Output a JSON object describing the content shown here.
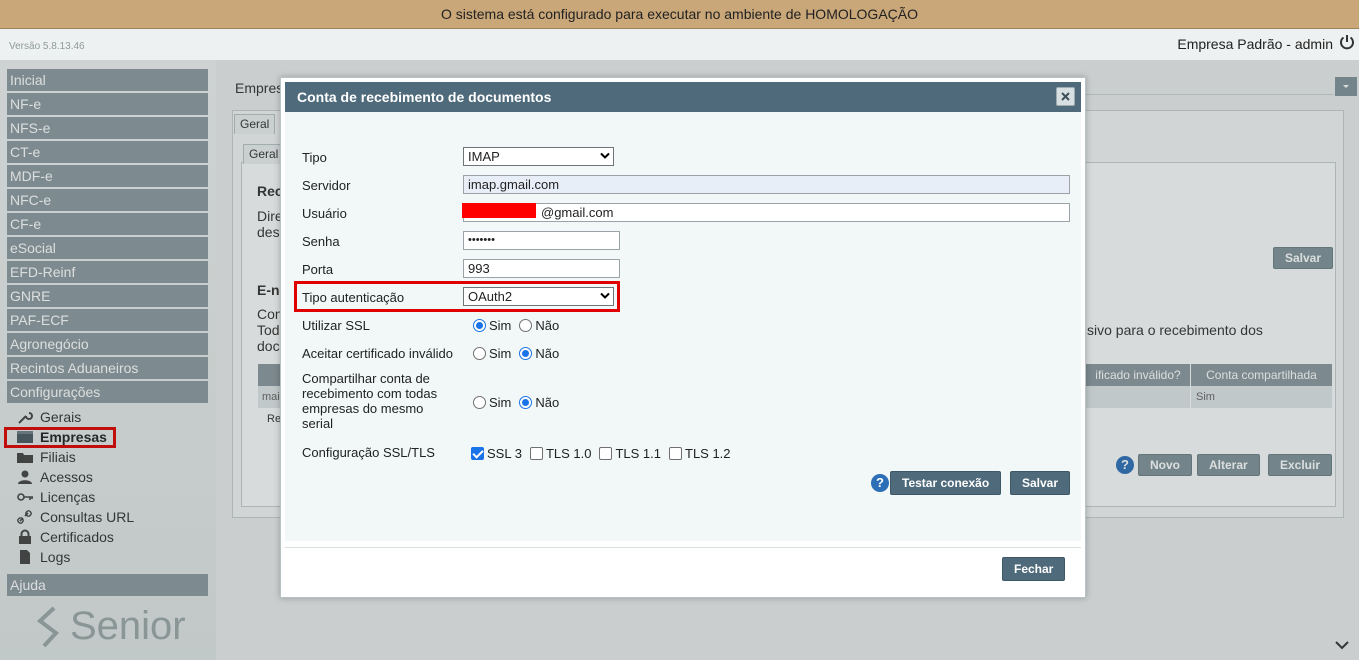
{
  "banner": {
    "text": "O sistema está configurado para executar no ambiente de HOMOLOGAÇÃO"
  },
  "header": {
    "version": "Versão 5.8.13.46",
    "user": "Empresa Padrão - admin"
  },
  "sidebar": {
    "menu": [
      "Inicial",
      "NF-e",
      "NFS-e",
      "CT-e",
      "MDF-e",
      "NFC-e",
      "CF-e",
      "eSocial",
      "EFD-Reinf",
      "GNRE",
      "PAF-ECF",
      "Agronegócio",
      "Recintos Aduaneiros",
      "Configurações"
    ],
    "config_items": [
      {
        "label": "Gerais",
        "icon": "wrench-icon"
      },
      {
        "label": "Empresas",
        "icon": "building-icon"
      },
      {
        "label": "Filiais",
        "icon": "folder-icon"
      },
      {
        "label": "Acessos",
        "icon": "user-icon"
      },
      {
        "label": "Licenças",
        "icon": "key-icon"
      },
      {
        "label": "Consultas URL",
        "icon": "link-icon"
      },
      {
        "label": "Certificados",
        "icon": "lock-icon"
      },
      {
        "label": "Logs",
        "icon": "document-icon"
      }
    ],
    "help": "Ajuda",
    "logo": "Senior"
  },
  "background": {
    "empresa_label": "Empres",
    "tab_outer": "Geral",
    "tab_inner": "Geral",
    "section1_title": "Rec",
    "section1_line1": "Dire",
    "section1_line2": "des",
    "section2_title": "E-n",
    "section2_line1": "Con",
    "section2_line2": "Tod",
    "section2_line3": "doc",
    "section2_right_text": "sivo para o recebimento dos",
    "salvar": "Salvar",
    "th_cert": "ificado inválido?",
    "th_shared": "Conta compartilhada",
    "row_first": "mai",
    "row_shared": "Sim",
    "row_next": "Re",
    "novo": "Novo",
    "alterar": "Alterar",
    "excluir": "Excluir"
  },
  "modal": {
    "title": "Conta de recebimento de documentos",
    "labels": {
      "tipo": "Tipo",
      "servidor": "Servidor",
      "usuario": "Usuário",
      "senha": "Senha",
      "porta": "Porta",
      "tipo_auth": "Tipo autenticação",
      "ssl": "Utilizar SSL",
      "aceitar": "Aceitar certificado inválido",
      "compartilhar": "Compartilhar conta de recebimento com todas empresas do mesmo serial",
      "config_ssl": "Configuração SSL/TLS"
    },
    "values": {
      "tipo": "IMAP",
      "servidor": "imap.gmail.com",
      "usuario_suffix": "@gmail.com",
      "senha": "•••••••",
      "porta": "993",
      "tipo_auth": "OAuth2"
    },
    "radio": {
      "sim": "Sim",
      "nao": "Não"
    },
    "ssl_options": [
      "SSL 3",
      "TLS 1.0",
      "TLS 1.1",
      "TLS 1.2"
    ],
    "buttons": {
      "testar": "Testar conexão",
      "salvar": "Salvar",
      "fechar": "Fechar"
    }
  }
}
